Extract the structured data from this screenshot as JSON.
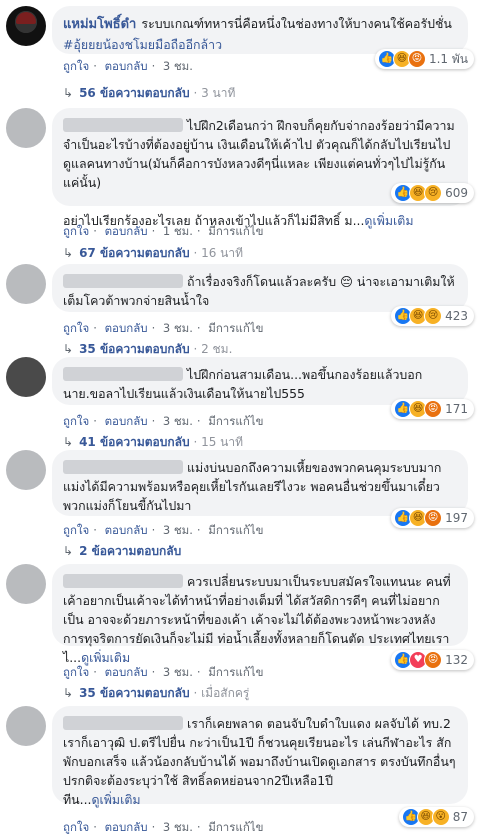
{
  "comments": [
    {
      "author": "แหม่มโพธิ์ดำ",
      "text": "ระบบเกณฑ์ทหารนี่คือหนึ่งในช่องทางให้บางคนใช้คอรัปชั่น ",
      "tag": "#อุ้ยยยน้องชโมยมือถืออีกล้าว",
      "reactions": {
        "icons": [
          "like",
          "haha",
          "angry"
        ],
        "count": "1.1 พัน"
      },
      "actions": {
        "like": "ถูกใจ",
        "reply": "ตอบกลับ",
        "time": "3 ชม."
      },
      "replies": {
        "label": "56 ข้อความตอบกลับ",
        "time": "3 นาที"
      }
    },
    {
      "author": "",
      "text": "ไปฝึก2เดือนกว่า ฝึกจบก็คุยกับจ่ากองร้อยว่ามีความจำเป็นอะไรบ้างที่ต้องอยู่บ้าน เงินเดือนให้เค้าไป ตัวคุณก็ได้กลับไปเรียนไปดูแลคนทางบ้าน(มันก็คือการบังหลวงดีๆนี่แหละ เพียงแต่คนทั่วๆไปไม่รู้กันแค่นั้น)\n\nอย่าไปเรียกร้องอะไรเลย ถ้าหลงเข้าไปแล้วก็ไม่มีสิทธิ์ ม...",
      "more": "ดูเพิ่มเติม",
      "reactions": {
        "icons": [
          "like",
          "haha",
          "sad"
        ],
        "count": "609"
      },
      "actions": {
        "like": "ถูกใจ",
        "reply": "ตอบกลับ",
        "time": "1 ชม.",
        "edited": "มีการแก้ไข"
      },
      "replies": {
        "label": "67 ข้อความตอบกลับ",
        "time": "16 นาที"
      }
    },
    {
      "author": "",
      "text": "ถ้าเรื่องจริงก็โดนแล้วละครับ 😔 น่าจะเอามาเติมให้เต็มโควต้าพวกจ่ายสินน้ำใจ",
      "reactions": {
        "icons": [
          "like",
          "haha",
          "sad"
        ],
        "count": "423"
      },
      "actions": {
        "like": "ถูกใจ",
        "reply": "ตอบกลับ",
        "time": "3 ชม.",
        "edited": "มีการแก้ไข"
      },
      "replies": {
        "label": "35 ข้อความตอบกลับ",
        "time": "2 ชม."
      }
    },
    {
      "author": "",
      "text": "ไปฝึกก่อนสามเดือน...พอขึ้นกองร้อยแล้วบอกนาย.ขอลาไปเรียนแล้วเงินเดือนให้นายไป555",
      "reactions": {
        "icons": [
          "like",
          "haha",
          "angry"
        ],
        "count": "171"
      },
      "actions": {
        "like": "ถูกใจ",
        "reply": "ตอบกลับ",
        "time": "3 ชม.",
        "edited": "มีการแก้ไข"
      },
      "replies": {
        "label": "41 ข้อความตอบกลับ",
        "time": "15 นาที"
      }
    },
    {
      "author": "",
      "text": "แม่งบ่นบอกถึงความเหี้ยของพวกคนคุมระบบมาก แม่งได้มีความพร้อมหรือคุยเหี้ยไรกันเลยรึไงวะ พอคนอื่นช่วยขึ้นมาเดี๋ยวพวกแม่งก็โยนขี้กันไปมา",
      "reactions": {
        "icons": [
          "like",
          "haha",
          "angry"
        ],
        "count": "197"
      },
      "actions": {
        "like": "ถูกใจ",
        "reply": "ตอบกลับ",
        "time": "3 ชม.",
        "edited": "มีการแก้ไข"
      },
      "replies": {
        "label": "2 ข้อความตอบกลับ",
        "time": ""
      }
    },
    {
      "author": "",
      "text": "ควรเปลี่ยนระบบมาเป็นระบบสมัครใจแทนนะ คนที่เค้าอยากเป็นเค้าจะได้ทำหน้าที่อย่างเต็มที่ ได้สวัสดิการดีๆ คนที่ไม่อยากเป็น อาจจะด้วยภาระหน้าที่ของเค้า เค้าจะไม่ได้ต้องพะวงหน้าพะวงหลัง การทุจริตการยัดเงินก็จะไม่มี ท่อน้ำเลี้ยงทั้งหลายก็โดนตัด ประเทศไทยเราไ...",
      "more": "ดูเพิ่มเติม",
      "reactions": {
        "icons": [
          "like",
          "love",
          "angry"
        ],
        "count": "132"
      },
      "actions": {
        "like": "ถูกใจ",
        "reply": "ตอบกลับ",
        "time": "3 ชม.",
        "edited": "มีการแก้ไข"
      },
      "replies": {
        "label": "35 ข้อความตอบกลับ",
        "time": "เมื่อสักครู่"
      }
    },
    {
      "author": "",
      "text": "เราก็เคยพลาด ตอนจับใบดำใบแดง ผลจับได้ ทบ.2 เราก็เอาวุฒิ ป.ตรีไปยื่น กะว่าเป็น1ปี ก็ชวนคุยเรียนอะไร เล่นกีฬาอะไร สักพักบอกเสร็จ แล้วน้องกลับบ้านได้ พอมาถึงบ้านเปิดดูเอกสาร ตรงบันทึกอื่นๆ ปรกติจะต้องระบุว่าใช้ สิทธิ์ลดหย่อนจาก2ปีเหลือ1ปี\nทีน...",
      "more": "ดูเพิ่มเติม",
      "reactions": {
        "icons": [
          "like",
          "haha",
          "wow"
        ],
        "count": "87"
      },
      "actions": {
        "like": "ถูกใจ",
        "reply": "ตอบกลับ",
        "time": "3 ชม.",
        "edited": "มีการแก้ไข"
      }
    }
  ],
  "reaction_glyphs": {
    "like": "👍",
    "haha": "😆",
    "sad": "😢",
    "angry": "😡",
    "love": "♥",
    "wow": "😮"
  }
}
